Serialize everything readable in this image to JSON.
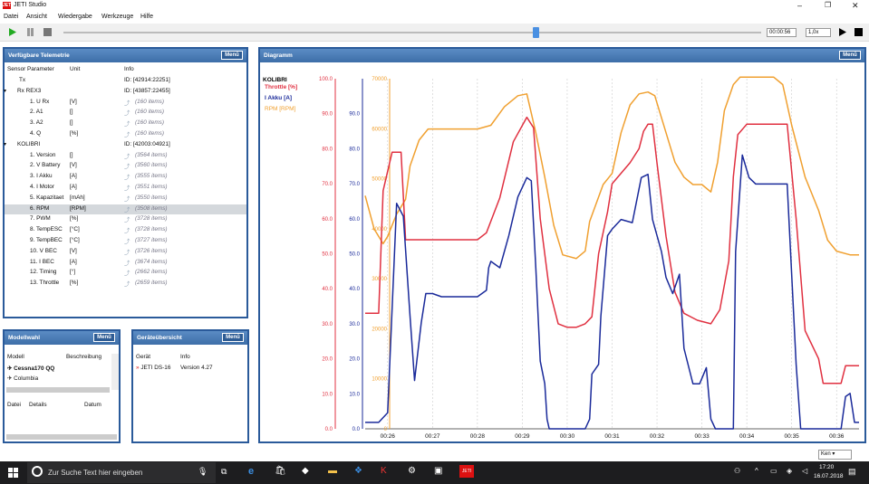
{
  "window": {
    "title": "JETI Studio",
    "logo": "JETI",
    "controls": [
      "minimize-icon",
      "restore-icon",
      "close-icon"
    ]
  },
  "menu": [
    "Datei",
    "Ansicht",
    "Wiedergabe",
    "Werkzeuge",
    "Hilfe"
  ],
  "toolbar": {
    "time": "00:00:56",
    "speed": "1,0x"
  },
  "telemetry": {
    "title": "Verfügbare Telemetrie",
    "menu_label": "Menü",
    "headers": {
      "param": "Sensor Parameter",
      "unit": "Unit",
      "info": "Info"
    },
    "rows": [
      {
        "p": "Tx",
        "u": "",
        "i": "ID: [42914:22251]",
        "lvl": 1
      },
      {
        "p": "Rx REX3",
        "u": "",
        "i": "ID: [43857:22455]",
        "lvl": 0
      },
      {
        "p": "1. U Rx",
        "u": "[V]",
        "i": "(160 items)",
        "lvl": 2
      },
      {
        "p": "2. A1",
        "u": "[]",
        "i": "(160 items)",
        "lvl": 2
      },
      {
        "p": "3. A2",
        "u": "[]",
        "i": "(160 items)",
        "lvl": 2
      },
      {
        "p": "4. Q",
        "u": "[%]",
        "i": "(160 items)",
        "lvl": 2
      },
      {
        "p": "KOLIBRI",
        "u": "",
        "i": "ID: [42003:04921]",
        "lvl": 0
      },
      {
        "p": "1. Version",
        "u": "[]",
        "i": "(3564 items)",
        "lvl": 2
      },
      {
        "p": "2. V Battery",
        "u": "[V]",
        "i": "(3560 items)",
        "lvl": 2
      },
      {
        "p": "3. I Akku",
        "u": "[A]",
        "i": "(3555 items)",
        "lvl": 2
      },
      {
        "p": "4. I Motor",
        "u": "[A]",
        "i": "(3551 items)",
        "lvl": 2
      },
      {
        "p": "5. Kapazitaet",
        "u": "[mAh]",
        "i": "(3550 items)",
        "lvl": 2
      },
      {
        "p": "6. RPM",
        "u": "[RPM]",
        "i": "(3508 items)",
        "lvl": 2
      },
      {
        "p": "7. PWM",
        "u": "[%]",
        "i": "(3728 items)",
        "lvl": 2
      },
      {
        "p": "8. TempESC",
        "u": "[°C]",
        "i": "(3728 items)",
        "lvl": 2
      },
      {
        "p": "9. TempBEC",
        "u": "[°C]",
        "i": "(3727 items)",
        "lvl": 2
      },
      {
        "p": "10. V BEC",
        "u": "[V]",
        "i": "(3726 items)",
        "lvl": 2
      },
      {
        "p": "11. I BEC",
        "u": "[A]",
        "i": "(3674 items)",
        "lvl": 2
      },
      {
        "p": "12. Timing",
        "u": "[°]",
        "i": "(2662 items)",
        "lvl": 2
      },
      {
        "p": "13. Throttle",
        "u": "[%]",
        "i": "(2659 items)",
        "lvl": 2
      }
    ],
    "selected_index": 12
  },
  "models": {
    "title": "Modellwahl",
    "menu_label": "Menü",
    "col_model": "Modell",
    "col_desc": "Beschreibung",
    "items": [
      "Cessna170 QQ",
      "Columbia"
    ],
    "col_file": "Datei",
    "col_details": "Details",
    "col_date": "Datum"
  },
  "devices": {
    "title": "Geräteübersicht",
    "menu_label": "Menü",
    "col_device": "Gerät",
    "col_info": "Info",
    "items": [
      {
        "name": "JETI DS-16",
        "info": "Version 4.27"
      }
    ]
  },
  "diagram": {
    "title": "Diagramm",
    "menu_label": "Menü",
    "zoom": "Ken"
  },
  "chart_data": {
    "type": "line",
    "legend": {
      "header": "KOLIBRI",
      "placement": "top-left"
    },
    "series": [
      {
        "name": "Throttle [%]",
        "color": "#e03040",
        "axis": "left1"
      },
      {
        "name": "I Akku [A]",
        "color": "#1a2a9a",
        "axis": "left2"
      },
      {
        "name": "RPM [RPM]",
        "color": "#f0a030",
        "axis": "left3"
      }
    ],
    "x_ticks": [
      "00:26",
      "00:27",
      "00:28",
      "00:29",
      "00:30",
      "00:31",
      "00:32",
      "00:33",
      "00:34",
      "00:35",
      "00:36"
    ],
    "x_range": [
      25.5,
      36.5
    ],
    "axis_throttle": {
      "ylim": [
        0,
        100
      ],
      "ticks": [
        "0.0",
        "10.0",
        "20.0",
        "30.0",
        "40.0",
        "50.0",
        "60.0",
        "70.0",
        "80.0",
        "90.0",
        "100.0"
      ]
    },
    "axis_iakku": {
      "ylim": [
        0,
        100
      ],
      "ticks": [
        "0.0",
        "10.0",
        "20.0",
        "30.0",
        "40.0",
        "50.0",
        "60.0",
        "70.0",
        "80.0",
        "90.0"
      ]
    },
    "axis_rpm": {
      "ylim": [
        0,
        70000
      ],
      "ticks": [
        "0",
        "10000",
        "20000",
        "30000",
        "40000",
        "50000",
        "60000",
        "70000"
      ]
    },
    "throttle": [
      [
        25.5,
        33
      ],
      [
        25.8,
        33
      ],
      [
        25.9,
        68
      ],
      [
        26.1,
        79
      ],
      [
        26.3,
        79
      ],
      [
        26.4,
        54
      ],
      [
        26.6,
        54
      ],
      [
        27.3,
        54
      ],
      [
        28.0,
        54
      ],
      [
        28.2,
        56
      ],
      [
        28.5,
        66
      ],
      [
        28.8,
        82
      ],
      [
        29.1,
        89
      ],
      [
        29.25,
        86
      ],
      [
        29.4,
        60
      ],
      [
        29.6,
        40
      ],
      [
        29.8,
        30
      ],
      [
        30.0,
        29
      ],
      [
        30.2,
        29
      ],
      [
        30.4,
        30
      ],
      [
        30.55,
        32
      ],
      [
        30.7,
        50
      ],
      [
        30.9,
        62
      ],
      [
        31.0,
        70
      ],
      [
        31.2,
        73
      ],
      [
        31.4,
        76
      ],
      [
        31.6,
        80
      ],
      [
        31.7,
        85
      ],
      [
        31.8,
        87
      ],
      [
        31.9,
        87
      ],
      [
        32.0,
        76
      ],
      [
        32.2,
        55
      ],
      [
        32.4,
        39
      ],
      [
        32.6,
        33
      ],
      [
        32.9,
        31
      ],
      [
        33.2,
        30
      ],
      [
        33.4,
        34
      ],
      [
        33.6,
        48
      ],
      [
        33.7,
        72
      ],
      [
        33.8,
        84
      ],
      [
        34.0,
        87
      ],
      [
        34.9,
        87
      ],
      [
        35.1,
        60
      ],
      [
        35.3,
        28
      ],
      [
        35.6,
        20
      ],
      [
        35.7,
        13
      ],
      [
        36.1,
        13
      ],
      [
        36.2,
        18
      ],
      [
        36.5,
        18
      ]
    ],
    "iakku": [
      [
        25.5,
        2
      ],
      [
        25.8,
        2
      ],
      [
        26.0,
        5
      ],
      [
        26.2,
        70
      ],
      [
        26.35,
        66
      ],
      [
        26.5,
        35
      ],
      [
        26.6,
        15
      ],
      [
        26.75,
        33
      ],
      [
        26.85,
        42
      ],
      [
        27.0,
        42
      ],
      [
        27.2,
        41
      ],
      [
        28.0,
        41
      ],
      [
        28.2,
        43
      ],
      [
        28.25,
        50
      ],
      [
        28.3,
        52
      ],
      [
        28.5,
        50
      ],
      [
        28.7,
        60
      ],
      [
        28.9,
        72
      ],
      [
        29.1,
        78
      ],
      [
        29.2,
        77
      ],
      [
        29.3,
        50
      ],
      [
        29.4,
        21
      ],
      [
        29.5,
        14
      ],
      [
        29.55,
        3
      ],
      [
        29.6,
        0
      ],
      [
        30.1,
        0
      ],
      [
        30.4,
        0
      ],
      [
        30.5,
        3
      ],
      [
        30.55,
        17
      ],
      [
        30.7,
        20
      ],
      [
        30.75,
        35
      ],
      [
        30.9,
        60
      ],
      [
        31.0,
        62
      ],
      [
        31.2,
        65
      ],
      [
        31.45,
        64
      ],
      [
        31.65,
        78
      ],
      [
        31.8,
        79
      ],
      [
        31.9,
        65
      ],
      [
        32.1,
        55
      ],
      [
        32.2,
        47
      ],
      [
        32.35,
        42
      ],
      [
        32.5,
        48
      ],
      [
        32.6,
        25
      ],
      [
        32.8,
        14
      ],
      [
        32.95,
        14
      ],
      [
        33.1,
        19
      ],
      [
        33.2,
        3
      ],
      [
        33.3,
        0
      ],
      [
        33.7,
        0
      ],
      [
        33.75,
        55
      ],
      [
        33.9,
        85
      ],
      [
        34.05,
        78
      ],
      [
        34.2,
        76
      ],
      [
        34.9,
        76
      ],
      [
        35.1,
        20
      ],
      [
        35.2,
        0
      ],
      [
        36.1,
        0
      ],
      [
        36.2,
        10
      ],
      [
        36.3,
        11
      ],
      [
        36.4,
        2
      ],
      [
        36.5,
        2
      ]
    ],
    "rpm": [
      [
        25.5,
        63000
      ],
      [
        25.7,
        54000
      ],
      [
        25.9,
        50000
      ],
      [
        26.0,
        52000
      ],
      [
        26.2,
        58000
      ],
      [
        26.4,
        62000
      ],
      [
        26.5,
        71000
      ],
      [
        26.7,
        78000
      ],
      [
        26.9,
        81000
      ],
      [
        27.2,
        81000
      ],
      [
        28.0,
        81000
      ],
      [
        28.3,
        82000
      ],
      [
        28.6,
        87000
      ],
      [
        28.9,
        90000
      ],
      [
        29.1,
        90500
      ],
      [
        29.3,
        80000
      ],
      [
        29.5,
        68000
      ],
      [
        29.7,
        55000
      ],
      [
        29.9,
        47000
      ],
      [
        30.2,
        46000
      ],
      [
        30.4,
        48000
      ],
      [
        30.5,
        56000
      ],
      [
        30.8,
        66000
      ],
      [
        31.0,
        69000
      ],
      [
        31.2,
        80000
      ],
      [
        31.4,
        87500
      ],
      [
        31.6,
        90500
      ],
      [
        31.8,
        91000
      ],
      [
        31.95,
        90000
      ],
      [
        32.2,
        80000
      ],
      [
        32.4,
        72000
      ],
      [
        32.6,
        68000
      ],
      [
        32.8,
        66000
      ],
      [
        33.0,
        66000
      ],
      [
        33.2,
        64000
      ],
      [
        33.35,
        72000
      ],
      [
        33.5,
        86000
      ],
      [
        33.7,
        93000
      ],
      [
        33.85,
        95000
      ],
      [
        34.6,
        95000
      ],
      [
        34.8,
        93000
      ],
      [
        35.0,
        82000
      ],
      [
        35.3,
        68000
      ],
      [
        35.6,
        59000
      ],
      [
        35.8,
        51000
      ],
      [
        36.0,
        48000
      ],
      [
        36.3,
        47000
      ],
      [
        36.5,
        47000
      ]
    ]
  },
  "taskbar": {
    "search_placeholder": "Zur Suche Text hier eingeben",
    "time": "17:20",
    "date": "16.07.2018"
  }
}
